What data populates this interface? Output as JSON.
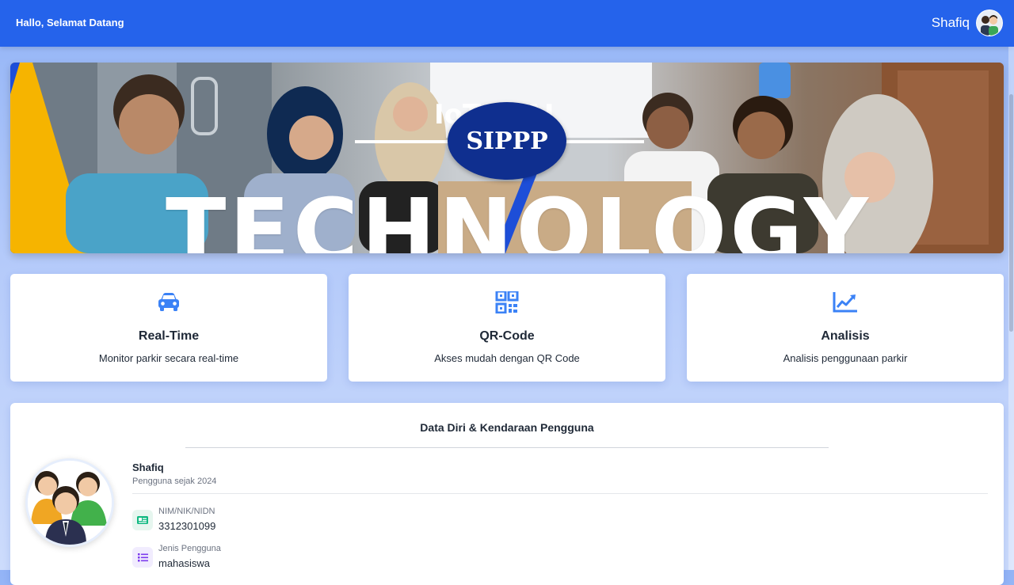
{
  "header": {
    "greeting": "Hallo, Selamat Datang",
    "user_name": "Shafiq",
    "avatar_icon": "user-avatar-icon",
    "color": "#2563eb"
  },
  "banner": {
    "logo_text": "SIPPP",
    "headline": "TECHNOLOGY",
    "top_text": "IoT & AI"
  },
  "features": [
    {
      "icon": "car-icon",
      "title": "Real-Time",
      "description": "Monitor parkir secara real-time"
    },
    {
      "icon": "qr-code-icon",
      "title": "QR-Code",
      "description": "Akses mudah dengan QR Code"
    },
    {
      "icon": "chart-line-icon",
      "title": "Analisis",
      "description": "Analisis penggunaan parkir"
    }
  ],
  "profile": {
    "section_title": "Data Diri & Kendaraan Pengguna",
    "name": "Shafiq",
    "since": "Pengguna sejak 2024",
    "fields": [
      {
        "icon": "id-card-icon",
        "label": "NIM/NIK/NIDN",
        "value": "3312301099"
      },
      {
        "icon": "list-icon",
        "label": "Jenis Pengguna",
        "value": "mahasiswa"
      }
    ]
  },
  "colors": {
    "accent": "#3b82f6",
    "text": "#1f2937",
    "muted": "#6b7280"
  }
}
